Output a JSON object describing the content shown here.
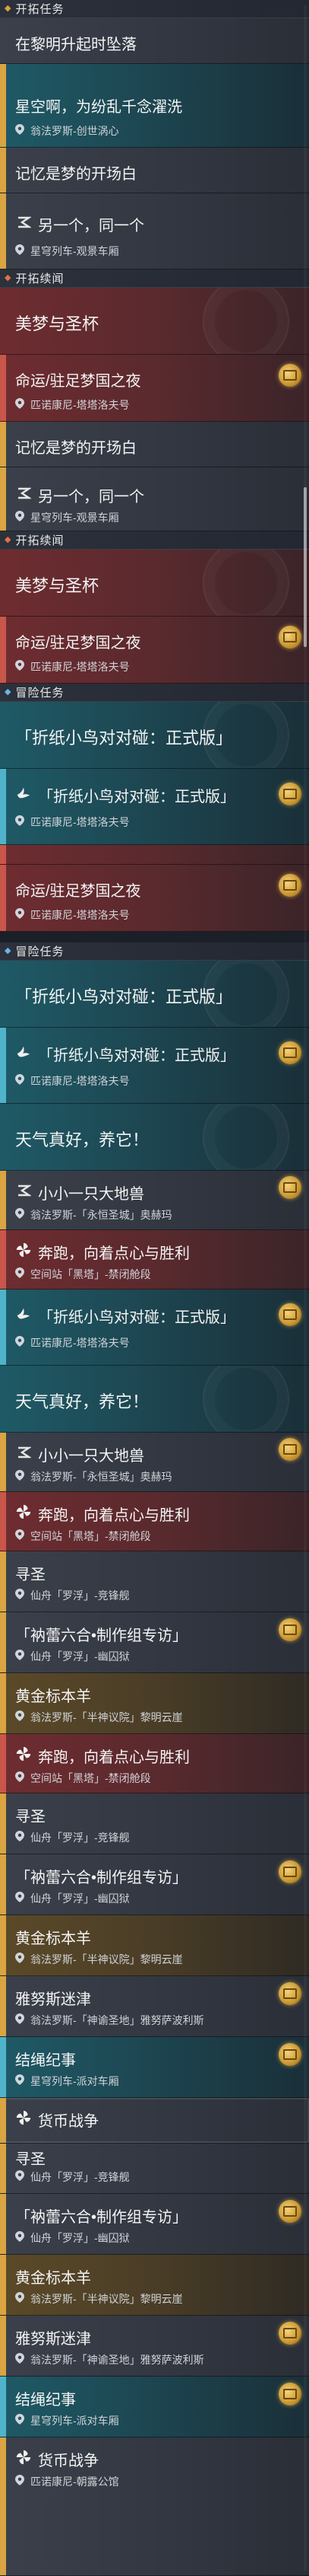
{
  "sections": {
    "open": "开拓任务",
    "companion": "开拓续闻",
    "adventure": "冒险任务"
  },
  "quests": {
    "dawn": {
      "title": "在黎明升起时坠落"
    },
    "stars": {
      "title": "星空啊，为纷乱千念濯洗",
      "location": "翁法罗斯-创世涡心"
    },
    "memory": {
      "title": "记忆是梦的开场白"
    },
    "another": {
      "title": "另一个，同一个",
      "location": "星穹列车-观景车厢"
    },
    "dream": {
      "title": "美梦与圣杯"
    },
    "fate": {
      "title": "命运/驻足梦国之夜",
      "location": "匹诺康尼-塔塔洛夫号"
    },
    "origami_header": {
      "title": "「折纸小鸟对对碰：正式版」"
    },
    "origami": {
      "title": "「折纸小鸟对对碰：正式版」",
      "location": "匹诺康尼-塔塔洛夫号"
    },
    "weather": {
      "title": "天气真好，养它！"
    },
    "beast": {
      "title": "小小一只大地兽",
      "location": "翁法罗斯-「永恒圣城」奥赫玛"
    },
    "run": {
      "title": "奔跑，向着点心与胜利",
      "location": "空间站「黑塔」-禁闭舱段"
    },
    "seek": {
      "title": "寻圣",
      "location": "仙舟「罗浮」-竞锋舰"
    },
    "ink": {
      "title": "「衲蕾六合•制作组专访」",
      "location": "仙舟「罗浮」-幽囚狱"
    },
    "golden": {
      "title": "黄金标本羊",
      "location": "翁法罗斯-「半神议院」黎明云崖"
    },
    "maze": {
      "title": "雅努斯迷津",
      "location": "翁法罗斯-「神谕圣地」雅努萨波利斯"
    },
    "knot": {
      "title": "结绳纪事",
      "location": "星穹列车-派对车厢"
    },
    "currency": {
      "title": "货币战争",
      "location": "匹诺康尼-朝露公馆"
    }
  },
  "colors": {
    "gold": "#d9a441",
    "teal": "#4fb4c9",
    "red": "#c9564b",
    "badge": "#f6d37a"
  },
  "icons": {
    "pin": "map-pin-icon",
    "badge": "reward-badge-icon",
    "pinwheel": "pinwheel-icon",
    "bird": "origami-bird-icon",
    "chevron": "chevron-icon"
  }
}
